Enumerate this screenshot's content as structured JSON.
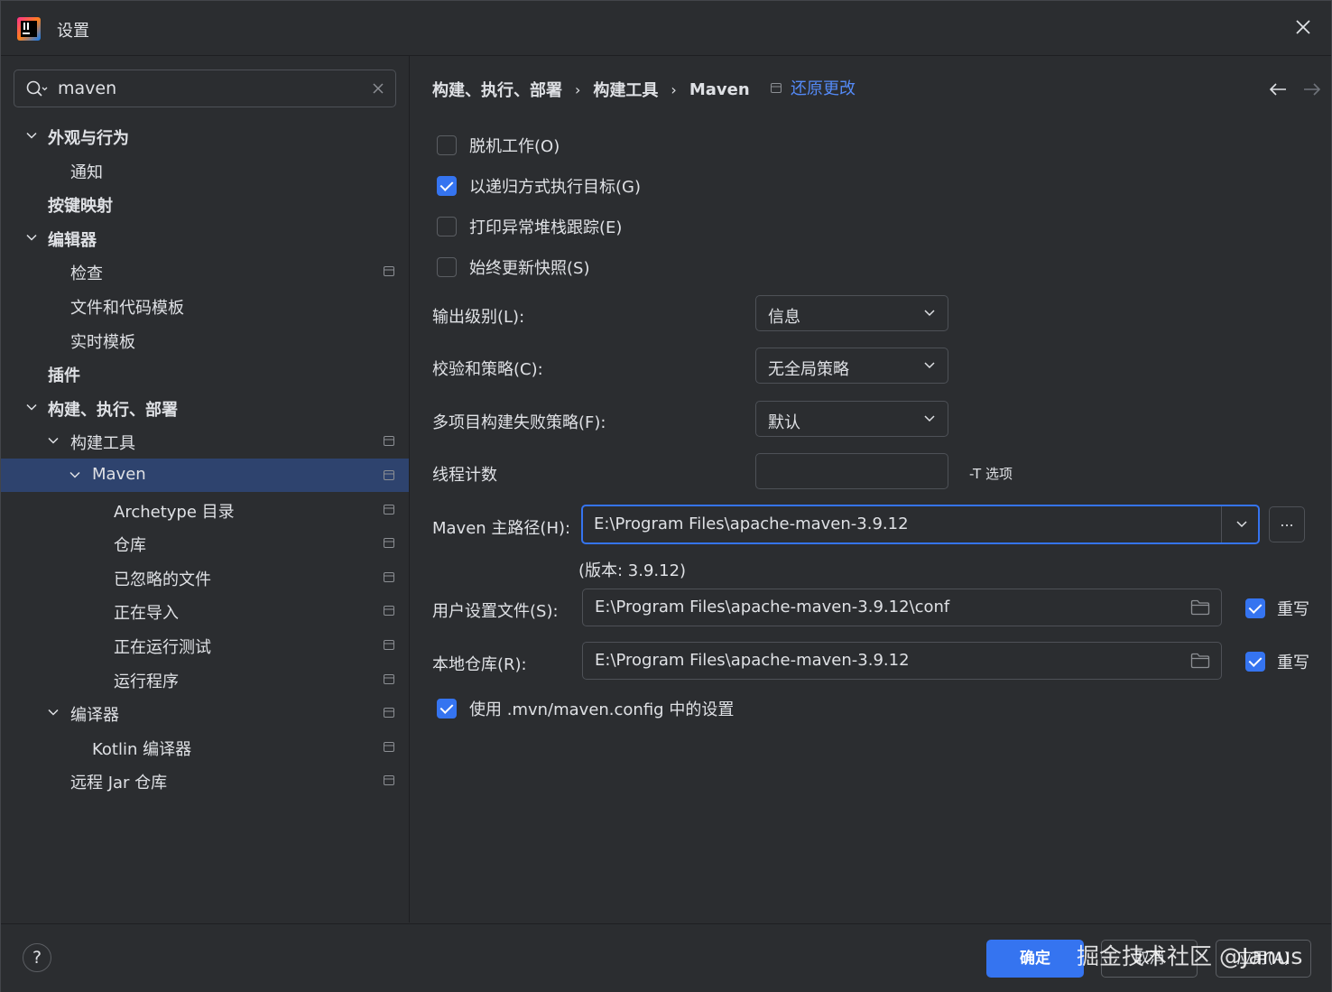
{
  "window": {
    "title": "设置"
  },
  "search": {
    "value": "maven"
  },
  "sidebar": {
    "items": [
      {
        "label": "外观与行为",
        "bold": true,
        "level": 0,
        "expandable": true
      },
      {
        "label": "通知",
        "bold": false,
        "level": 1,
        "expandable": false
      },
      {
        "label": "按键映射",
        "bold": true,
        "level": 0,
        "expandable": false
      },
      {
        "label": "编辑器",
        "bold": true,
        "level": 0,
        "expandable": true
      },
      {
        "label": "检查",
        "bold": false,
        "level": 1,
        "expandable": false,
        "project_icon": true
      },
      {
        "label": "文件和代码模板",
        "bold": false,
        "level": 1,
        "expandable": false
      },
      {
        "label": "实时模板",
        "bold": false,
        "level": 1,
        "expandable": false
      },
      {
        "label": "插件",
        "bold": true,
        "level": 0,
        "expandable": false
      },
      {
        "label": "构建、执行、部署",
        "bold": true,
        "level": 0,
        "expandable": true
      },
      {
        "label": "构建工具",
        "bold": false,
        "level": 1,
        "expandable": true,
        "project_icon": true
      },
      {
        "label": "Maven",
        "bold": false,
        "level": 2,
        "expandable": true,
        "project_icon": true,
        "selected": true
      },
      {
        "label": "Archetype 目录",
        "bold": false,
        "level": 3,
        "expandable": false,
        "project_icon": true
      },
      {
        "label": "仓库",
        "bold": false,
        "level": 3,
        "expandable": false,
        "project_icon": true
      },
      {
        "label": "已忽略的文件",
        "bold": false,
        "level": 3,
        "expandable": false,
        "project_icon": true
      },
      {
        "label": "正在导入",
        "bold": false,
        "level": 3,
        "expandable": false,
        "project_icon": true
      },
      {
        "label": "正在运行测试",
        "bold": false,
        "level": 3,
        "expandable": false,
        "project_icon": true
      },
      {
        "label": "运行程序",
        "bold": false,
        "level": 3,
        "expandable": false,
        "project_icon": true
      },
      {
        "label": "编译器",
        "bold": false,
        "level": 1,
        "expandable": true,
        "project_icon": true
      },
      {
        "label": "Kotlin 编译器",
        "bold": false,
        "level": 2,
        "expandable": false,
        "project_icon": true
      },
      {
        "label": "远程 Jar 仓库",
        "bold": false,
        "level": 1,
        "expandable": false,
        "project_icon": true
      }
    ]
  },
  "breadcrumb": [
    "构建、执行、部署",
    "构建工具",
    "Maven"
  ],
  "restore_label": "还原更改",
  "options": {
    "offline": {
      "label": "脱机工作(O)",
      "checked": false
    },
    "recursive": {
      "label": "以递归方式执行目标(G)",
      "checked": true
    },
    "stacktrace": {
      "label": "打印异常堆栈跟踪(E)",
      "checked": false
    },
    "snapshots": {
      "label": "始终更新快照(S)",
      "checked": false
    }
  },
  "output_level": {
    "label": "输出级别(L):",
    "value": "信息"
  },
  "checksum_policy": {
    "label": "校验和策略(C):",
    "value": "无全局策略"
  },
  "fail_policy": {
    "label": "多项目构建失败策略(F):",
    "value": "默认"
  },
  "thread_count": {
    "label": "线程计数",
    "value": "",
    "hint": "-T 选项"
  },
  "maven_home": {
    "label": "Maven 主路径(H):",
    "value": "E:\\Program Files\\apache-maven-3.9.12",
    "browse_label": "...",
    "version": "(版本: 3.9.12)"
  },
  "user_settings": {
    "label": "用户设置文件(S):",
    "value": "E:\\Program Files\\apache-maven-3.9.12\\conf",
    "override_label": "重写",
    "override": true
  },
  "local_repo": {
    "label": "本地仓库(R):",
    "value": "E:\\Program Files\\apache-maven-3.9.12",
    "override_label": "重写",
    "override": true
  },
  "mvn_config": {
    "label": "使用 .mvn/maven.config 中的设置",
    "checked": true
  },
  "buttons": {
    "help": "?",
    "ok": "确定",
    "cancel": "取消",
    "apply": "应用(A)"
  },
  "watermark": "掘金技术社区 @Janus",
  "colors": {
    "accent": "#3574f0",
    "link": "#548af7",
    "selection": "#2e436e",
    "background": "#2b2d30"
  }
}
